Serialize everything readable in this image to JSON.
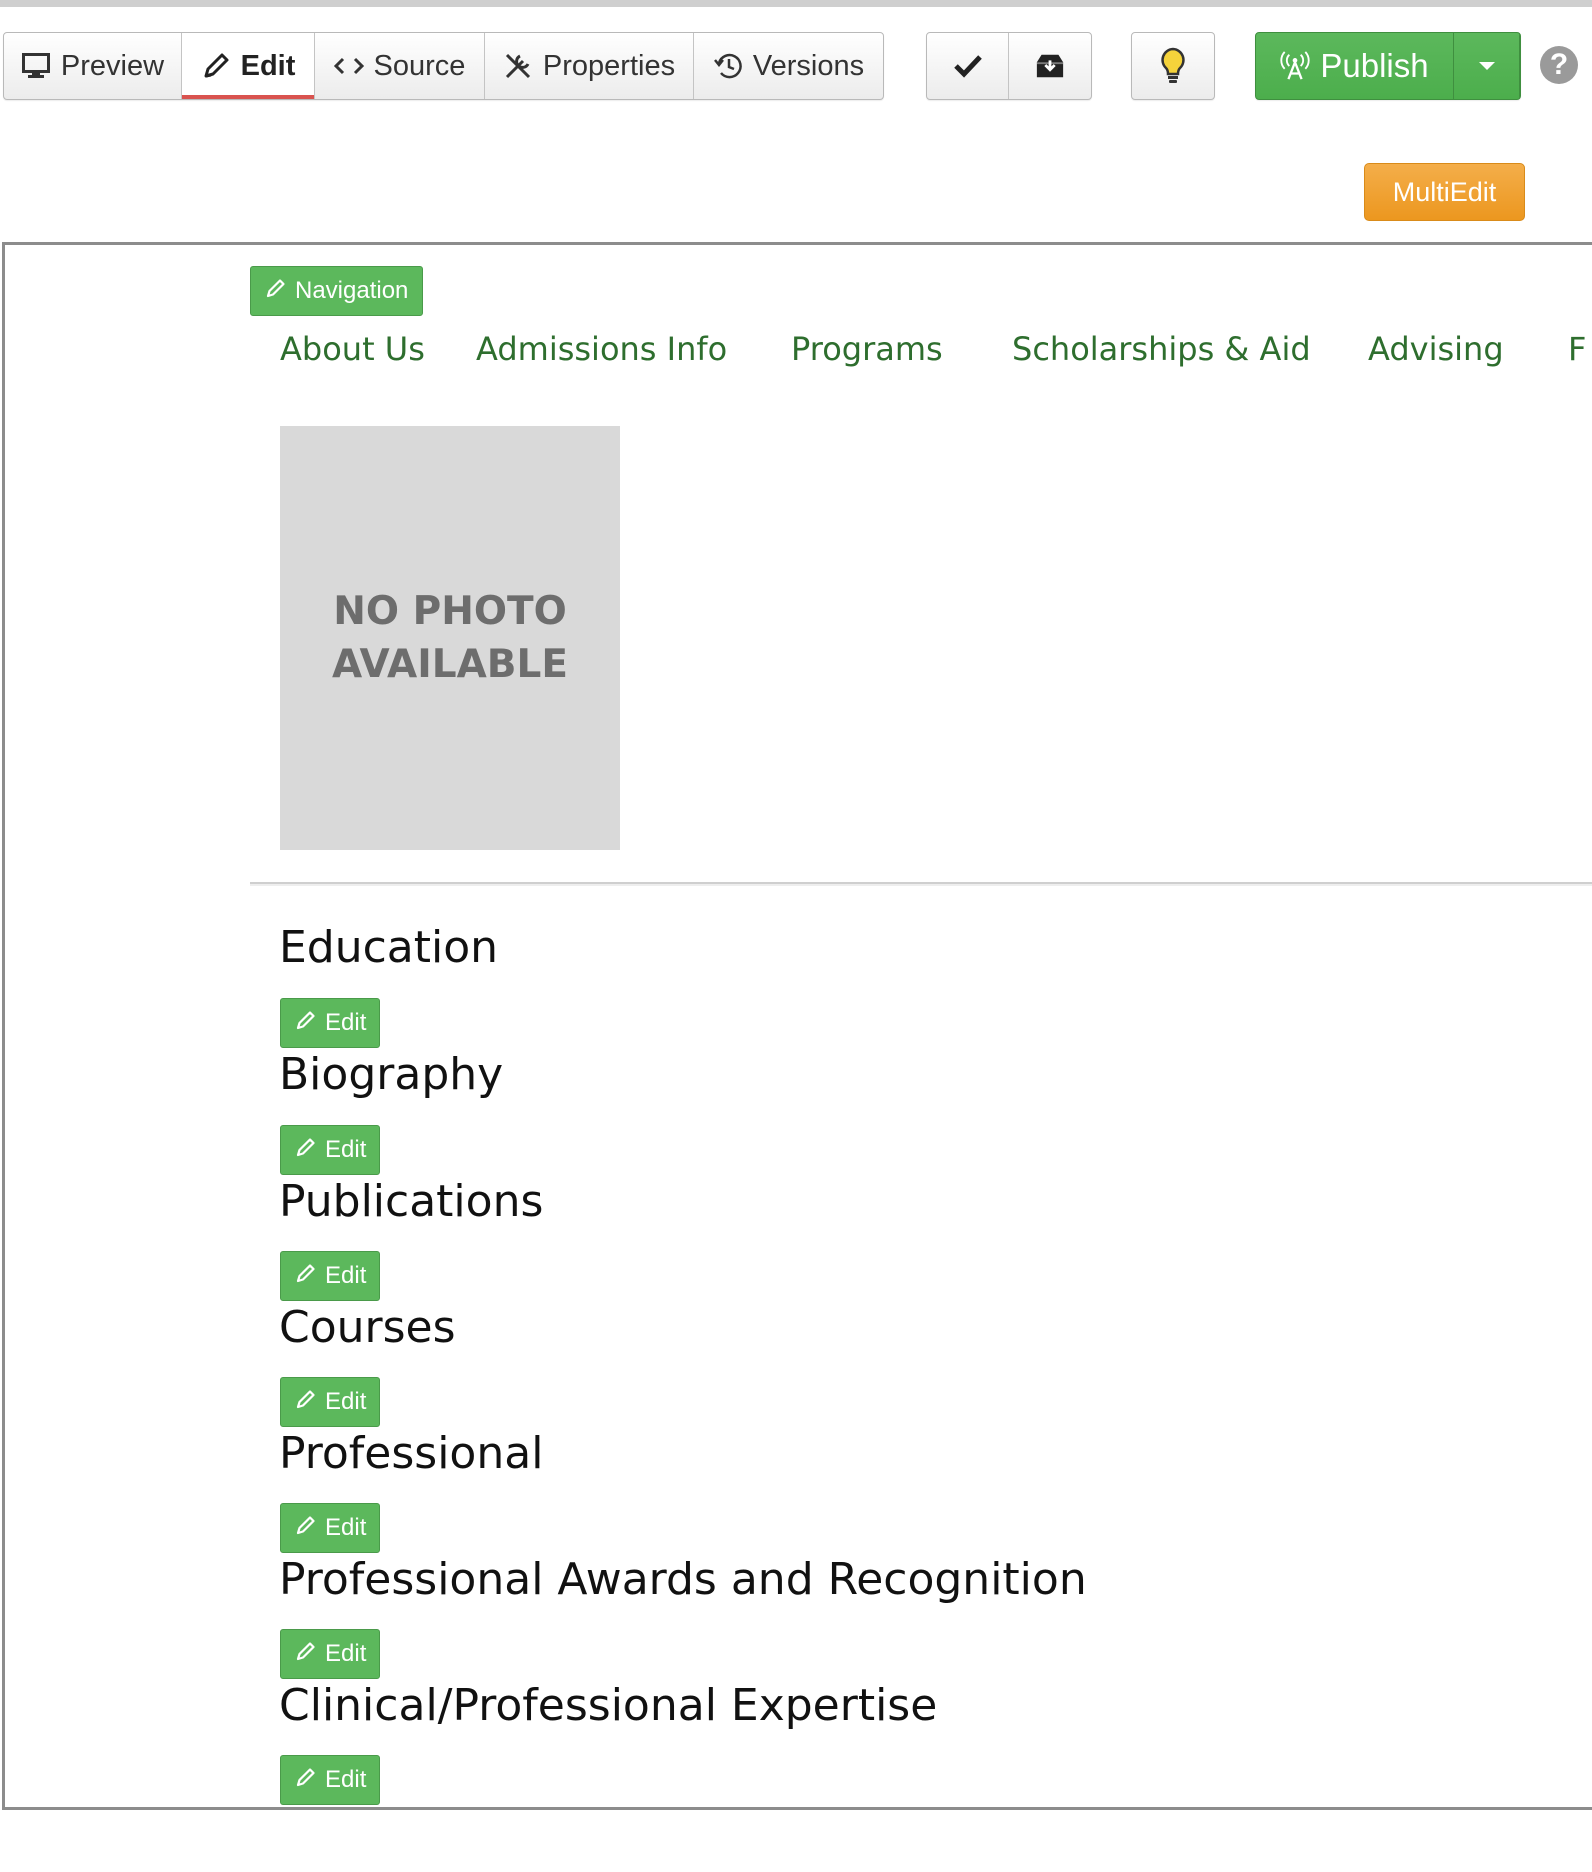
{
  "toolbar": {
    "modes": [
      {
        "label": "Preview",
        "icon": "monitor-icon"
      },
      {
        "label": "Edit",
        "icon": "pencil-icon",
        "active": true
      },
      {
        "label": "Source",
        "icon": "code-icon"
      },
      {
        "label": "Properties",
        "icon": "wrench-icon"
      },
      {
        "label": "Versions",
        "icon": "history-icon"
      }
    ],
    "actions": [
      "check-icon",
      "archive-icon"
    ],
    "tip_icon": "lightbulb-icon",
    "publish_label": "Publish",
    "help_label": "?",
    "accent_edit": "#d9534f",
    "publish_color": "#5cb85c"
  },
  "multiedit_label": "MultiEdit",
  "multiedit_color": "#ec971f",
  "navigation_label": "Navigation",
  "nav_items": [
    "About Us",
    "Admissions Info",
    "Programs",
    "Scholarships & Aid",
    "Advising",
    "F"
  ],
  "photo": {
    "line1": "NO PHOTO",
    "line2": "AVAILABLE"
  },
  "edit_label": "Edit",
  "sections": [
    "Education",
    "Biography",
    "Publications",
    "Courses",
    "Professional",
    "Professional Awards and Recognition",
    "Clinical/Professional Expertise"
  ]
}
